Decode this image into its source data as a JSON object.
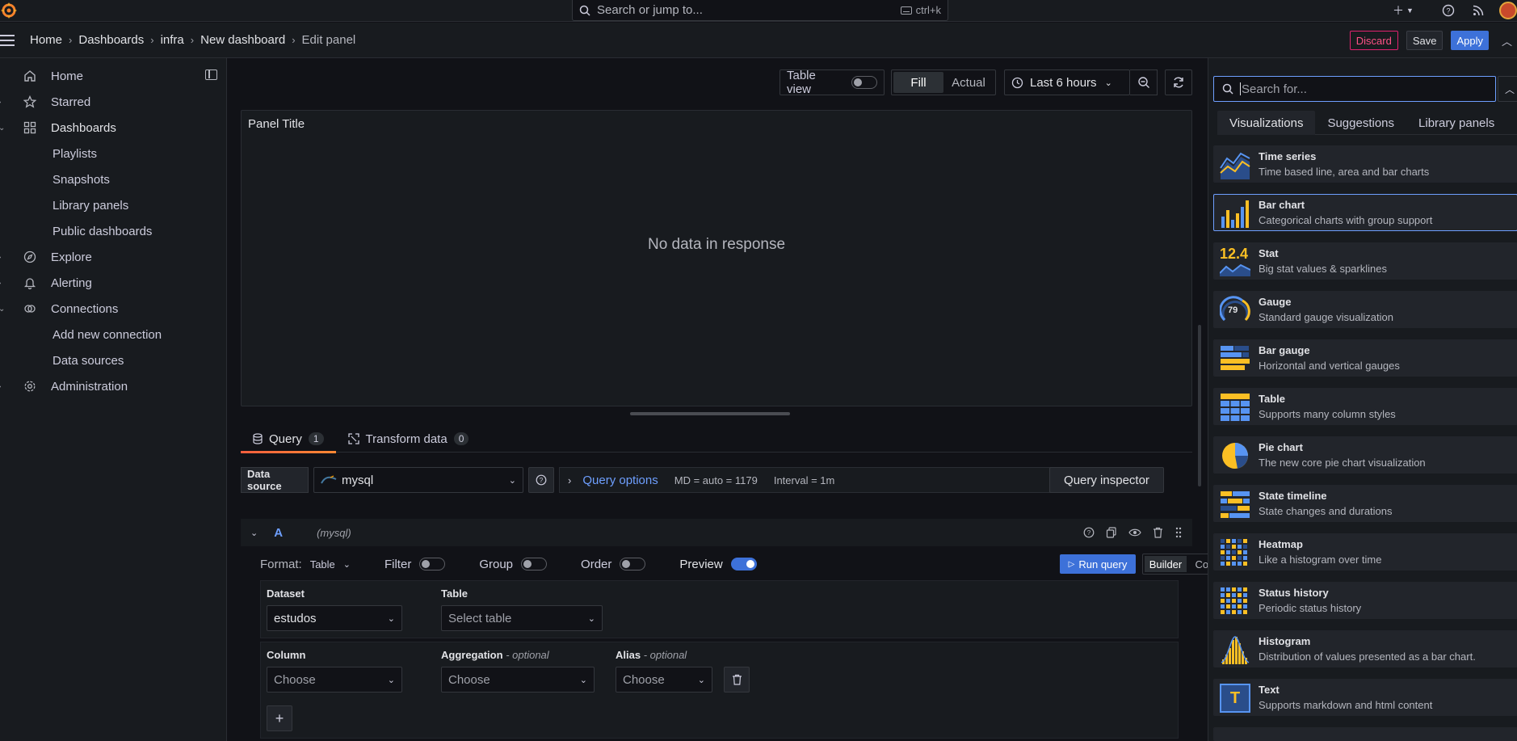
{
  "topbar": {
    "search_placeholder": "Search or jump to...",
    "search_shortcut": "ctrl+k"
  },
  "breadcrumbs": [
    "Home",
    "Dashboards",
    "infra",
    "New dashboard",
    "Edit panel"
  ],
  "actions": {
    "discard": "Discard",
    "save": "Save",
    "apply": "Apply"
  },
  "sidebar": {
    "items": [
      {
        "label": "Home",
        "icon": "home-icon"
      },
      {
        "label": "Starred",
        "icon": "star-icon"
      },
      {
        "label": "Dashboards",
        "icon": "apps-icon"
      },
      {
        "label": "Playlists"
      },
      {
        "label": "Snapshots"
      },
      {
        "label": "Library panels"
      },
      {
        "label": "Public dashboards"
      },
      {
        "label": "Explore",
        "icon": "compass-icon"
      },
      {
        "label": "Alerting",
        "icon": "bell-icon"
      },
      {
        "label": "Connections",
        "icon": "connections-icon"
      },
      {
        "label": "Add new connection"
      },
      {
        "label": "Data sources"
      },
      {
        "label": "Administration",
        "icon": "cog-icon"
      }
    ]
  },
  "panel_toolbar": {
    "table_view": "Table view",
    "table_view_on": false,
    "fill": "Fill",
    "actual": "Actual",
    "time_range": "Last 6 hours"
  },
  "panel": {
    "title": "Panel Title",
    "empty_text": "No data in response"
  },
  "editor_tabs": [
    {
      "label": "Query",
      "count": "1"
    },
    {
      "label": "Transform data",
      "count": "0"
    }
  ],
  "datasource": {
    "label": "Data source",
    "value": "mysql",
    "query_options_label": "Query options",
    "md": "MD = auto = 1179",
    "interval": "Interval = 1m",
    "inspector": "Query inspector"
  },
  "query": {
    "ref": "A",
    "ds_name": "(mysql)",
    "format_label": "Format:",
    "format_value": "Table",
    "filter": "Filter",
    "group": "Group",
    "order": "Order",
    "preview": "Preview",
    "preview_on": true,
    "run": "Run query",
    "builder": "Builder",
    "code": "Code",
    "dataset_label": "Dataset",
    "dataset_value": "estudos",
    "table_label": "Table",
    "table_placeholder": "Select table",
    "column_label": "Column",
    "aggregation_label": "Aggregation",
    "alias_label": "Alias",
    "optional": "- optional",
    "choose": "Choose"
  },
  "viz_picker": {
    "search_placeholder": "Search for...",
    "tabs": [
      "Visualizations",
      "Suggestions",
      "Library panels"
    ],
    "items": [
      {
        "name": "Time series",
        "desc": "Time based line, area and bar charts",
        "icon": "time-series-icon"
      },
      {
        "name": "Bar chart",
        "desc": "Categorical charts with group support",
        "icon": "bar-chart-icon",
        "selected": true
      },
      {
        "name": "Stat",
        "desc": "Big stat values & sparklines",
        "icon": "stat-icon",
        "icon_text": "12.4"
      },
      {
        "name": "Gauge",
        "desc": "Standard gauge visualization",
        "icon": "gauge-icon",
        "icon_text": "79"
      },
      {
        "name": "Bar gauge",
        "desc": "Horizontal and vertical gauges",
        "icon": "bar-gauge-icon"
      },
      {
        "name": "Table",
        "desc": "Supports many column styles",
        "icon": "table-icon"
      },
      {
        "name": "Pie chart",
        "desc": "The new core pie chart visualization",
        "icon": "pie-chart-icon"
      },
      {
        "name": "State timeline",
        "desc": "State changes and durations",
        "icon": "state-timeline-icon"
      },
      {
        "name": "Heatmap",
        "desc": "Like a histogram over time",
        "icon": "heatmap-icon"
      },
      {
        "name": "Status history",
        "desc": "Periodic status history",
        "icon": "status-history-icon"
      },
      {
        "name": "Histogram",
        "desc": "Distribution of values presented as a bar chart.",
        "icon": "histogram-icon"
      },
      {
        "name": "Text",
        "desc": "Supports markdown and html content",
        "icon": "text-icon",
        "icon_text": "T"
      }
    ]
  },
  "colors": {
    "accent_blue": "#3d71d9",
    "link_blue": "#6e9fff",
    "discard_red": "#ff5286",
    "tab_orange": "#f55f3e",
    "viz_yellow": "#fbbf24",
    "viz_blue": "#5794f2"
  }
}
